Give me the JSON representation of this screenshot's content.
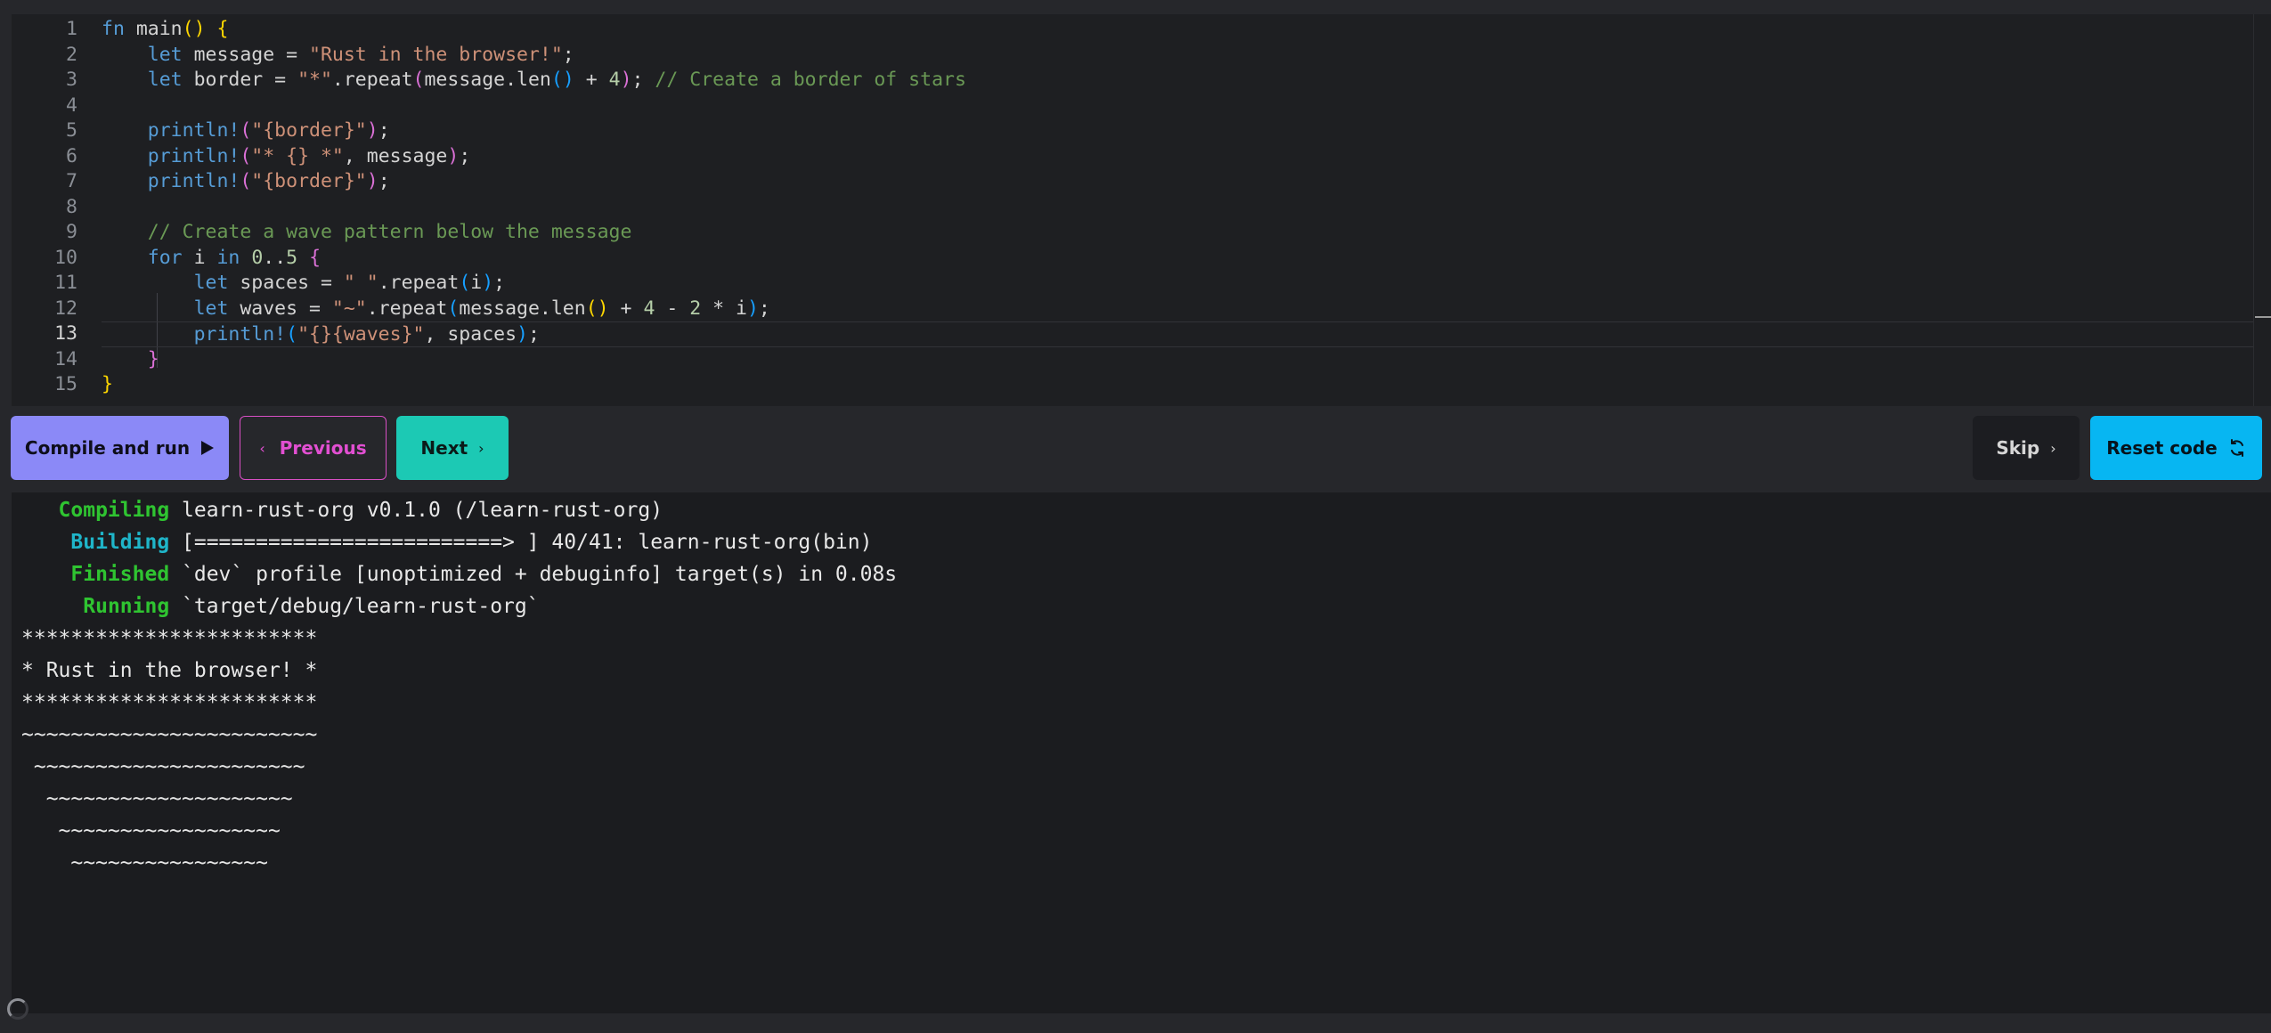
{
  "editor": {
    "line_numbers": [
      "1",
      "2",
      "3",
      "4",
      "5",
      "6",
      "7",
      "8",
      "9",
      "10",
      "11",
      "12",
      "13",
      "14",
      "15"
    ],
    "active_line": 13,
    "lines": [
      [
        {
          "t": "fn",
          "c": "kw"
        },
        {
          "t": " main"
        },
        {
          "t": "()",
          "c": "p1"
        },
        {
          "t": " "
        },
        {
          "t": "{",
          "c": "p1"
        }
      ],
      [
        {
          "t": "    "
        },
        {
          "t": "let",
          "c": "kw"
        },
        {
          "t": " message = "
        },
        {
          "t": "\"Rust in the browser!\"",
          "c": "str"
        },
        {
          "t": ";"
        }
      ],
      [
        {
          "t": "    "
        },
        {
          "t": "let",
          "c": "kw"
        },
        {
          "t": " border = "
        },
        {
          "t": "\"*\"",
          "c": "str"
        },
        {
          "t": ".repeat"
        },
        {
          "t": "(",
          "c": "p2"
        },
        {
          "t": "message.len"
        },
        {
          "t": "()",
          "c": "p3"
        },
        {
          "t": " + "
        },
        {
          "t": "4",
          "c": "num"
        },
        {
          "t": ")",
          "c": "p2"
        },
        {
          "t": "; "
        },
        {
          "t": "// Create a border of stars",
          "c": "cmt"
        }
      ],
      [],
      [
        {
          "t": "    "
        },
        {
          "t": "println!",
          "c": "kw"
        },
        {
          "t": "(",
          "c": "p2"
        },
        {
          "t": "\"{border}\"",
          "c": "str"
        },
        {
          "t": ")",
          "c": "p2"
        },
        {
          "t": ";"
        }
      ],
      [
        {
          "t": "    "
        },
        {
          "t": "println!",
          "c": "kw"
        },
        {
          "t": "(",
          "c": "p2"
        },
        {
          "t": "\"* {} *\"",
          "c": "str"
        },
        {
          "t": ", message"
        },
        {
          "t": ")",
          "c": "p2"
        },
        {
          "t": ";"
        }
      ],
      [
        {
          "t": "    "
        },
        {
          "t": "println!",
          "c": "kw"
        },
        {
          "t": "(",
          "c": "p2"
        },
        {
          "t": "\"{border}\"",
          "c": "str"
        },
        {
          "t": ")",
          "c": "p2"
        },
        {
          "t": ";"
        }
      ],
      [],
      [
        {
          "t": "    "
        },
        {
          "t": "// Create a wave pattern below the message",
          "c": "cmt"
        }
      ],
      [
        {
          "t": "    "
        },
        {
          "t": "for",
          "c": "kw"
        },
        {
          "t": " i "
        },
        {
          "t": "in",
          "c": "kw"
        },
        {
          "t": " "
        },
        {
          "t": "0",
          "c": "num"
        },
        {
          "t": ".."
        },
        {
          "t": "5",
          "c": "num"
        },
        {
          "t": " "
        },
        {
          "t": "{",
          "c": "p2"
        }
      ],
      [
        {
          "t": "        "
        },
        {
          "t": "let",
          "c": "kw"
        },
        {
          "t": " spaces = "
        },
        {
          "t": "\" \"",
          "c": "str"
        },
        {
          "t": ".repeat"
        },
        {
          "t": "(",
          "c": "p3"
        },
        {
          "t": "i"
        },
        {
          "t": ")",
          "c": "p3"
        },
        {
          "t": ";"
        }
      ],
      [
        {
          "t": "        "
        },
        {
          "t": "let",
          "c": "kw"
        },
        {
          "t": " waves = "
        },
        {
          "t": "\"~\"",
          "c": "str"
        },
        {
          "t": ".repeat"
        },
        {
          "t": "(",
          "c": "p3"
        },
        {
          "t": "message.len"
        },
        {
          "t": "()",
          "c": "p1"
        },
        {
          "t": " + "
        },
        {
          "t": "4",
          "c": "num"
        },
        {
          "t": " - "
        },
        {
          "t": "2",
          "c": "num"
        },
        {
          "t": " * i"
        },
        {
          "t": ")",
          "c": "p3"
        },
        {
          "t": ";"
        }
      ],
      [
        {
          "t": "        "
        },
        {
          "t": "println!",
          "c": "kw"
        },
        {
          "t": "(",
          "c": "p3"
        },
        {
          "t": "\"{}{waves}\"",
          "c": "str"
        },
        {
          "t": ", spaces"
        },
        {
          "t": ")",
          "c": "p3"
        },
        {
          "t": ";"
        }
      ],
      [
        {
          "t": "    "
        },
        {
          "t": "}",
          "c": "p2"
        }
      ],
      [
        {
          "t": "}",
          "c": "p1"
        }
      ]
    ]
  },
  "toolbar": {
    "compile_label": "Compile and run",
    "previous_label": "Previous",
    "next_label": "Next",
    "skip_label": "Skip",
    "reset_label": "Reset code"
  },
  "terminal": {
    "lines": [
      {
        "status": "Compiling",
        "status_color": "green",
        "indent": "   ",
        "text": " learn-rust-org v0.1.0 (/learn-rust-org)"
      },
      {
        "status": "Building",
        "status_color": "cyan",
        "indent": "    ",
        "text": " [=========================> ] 40/41: learn-rust-org(bin)"
      },
      {
        "status": "Finished",
        "status_color": "green",
        "indent": "    ",
        "text": " `dev` profile [unoptimized + debuginfo] target(s) in 0.08s"
      },
      {
        "status": "Running",
        "status_color": "green",
        "indent": "     ",
        "text": " `target/debug/learn-rust-org`"
      },
      {
        "text": "************************"
      },
      {
        "text": "* Rust in the browser! *"
      },
      {
        "text": "************************"
      },
      {
        "text": "~~~~~~~~~~~~~~~~~~~~~~~~"
      },
      {
        "text": " ~~~~~~~~~~~~~~~~~~~~~~"
      },
      {
        "text": "  ~~~~~~~~~~~~~~~~~~~~"
      },
      {
        "text": "   ~~~~~~~~~~~~~~~~~~"
      },
      {
        "text": "    ~~~~~~~~~~~~~~~~"
      }
    ]
  },
  "icons": {
    "compile": "play-icon",
    "previous": "chevron-left-icon",
    "next": "chevron-right-icon",
    "skip": "chevron-right-icon",
    "reset": "refresh-icon",
    "loading": "spinner-icon"
  },
  "colors": {
    "compile": "#8b89f7",
    "previous": "#e24fd2",
    "next": "#1cc9b4",
    "reset": "#07b6f2",
    "terminal_green": "#2fc431",
    "terminal_cyan": "#1fb5c9"
  }
}
